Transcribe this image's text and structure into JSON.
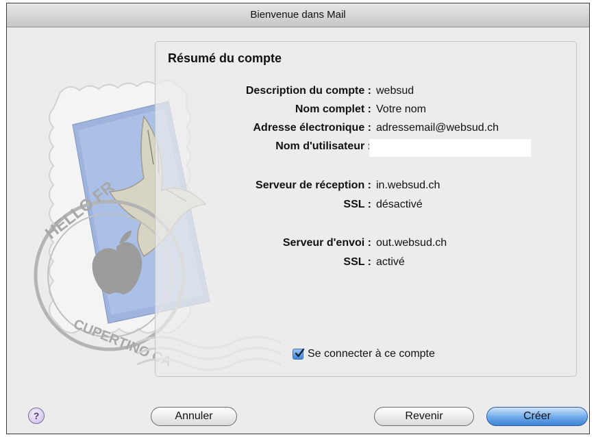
{
  "window": {
    "title": "Bienvenue dans Mail"
  },
  "summary": {
    "title": "Résumé du compte",
    "rows": [
      {
        "label": "Description du compte :",
        "value": "websud"
      },
      {
        "label": "Nom complet :",
        "value": "Votre nom"
      },
      {
        "label": "Adresse électronique :",
        "value": "adressemail@websud.ch"
      },
      {
        "label": "Nom d'utilisateur :",
        "value": ""
      },
      {
        "label": "Serveur de réception :",
        "value": "in.websud.ch"
      },
      {
        "label": "SSL :",
        "value": "désactivé"
      },
      {
        "label": "Serveur d'envoi :",
        "value": "out.websud.ch"
      },
      {
        "label": "SSL :",
        "value": "activé"
      }
    ]
  },
  "connect": {
    "label": "Se connecter à ce compte",
    "checked": true
  },
  "stamp": {
    "text_top": "HELLO FR",
    "text_bottom": "CUPERTINO CA"
  },
  "buttons": {
    "help": "?",
    "cancel": "Annuler",
    "back": "Revenir",
    "create": "Créer"
  },
  "colors": {
    "accent": "#3d82d6"
  }
}
